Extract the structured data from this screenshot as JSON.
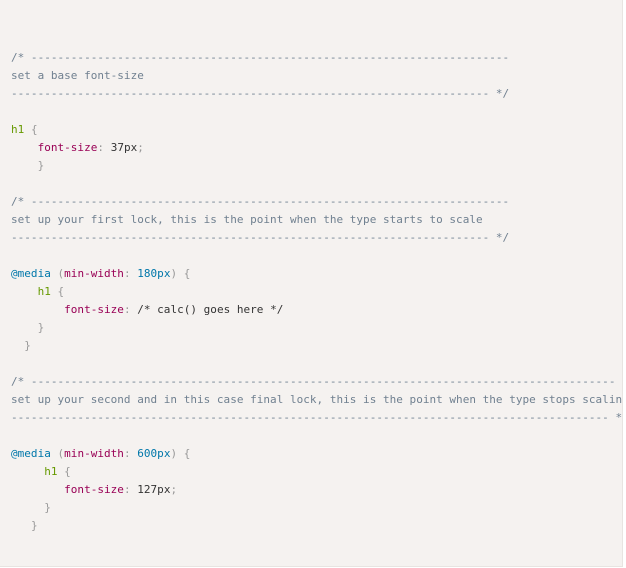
{
  "code": {
    "block1": {
      "comment_open": "/* ------------------------------------------------------------------------",
      "comment_text": "set a base font-size",
      "comment_close": "------------------------------------------------------------------------ */",
      "selector": "h1",
      "brace_open": " {",
      "property": "font-size",
      "colon": ":",
      "value": "37px",
      "semicolon": ";",
      "brace_close": "}"
    },
    "block2": {
      "comment_open": "/* ------------------------------------------------------------------------",
      "comment_text": "set up your first lock, this is the point when the type starts to scale",
      "comment_close": "------------------------------------------------------------------------ */",
      "at_rule": "@media",
      "paren_open": " (",
      "media_feature": "min-width",
      "media_colon": ": ",
      "media_value": "180px",
      "paren_close": ") {",
      "selector": "h1",
      "brace_open": " {",
      "property": "font-size",
      "colon": ":",
      "value": " /* calc() goes here */",
      "brace_close_inner": "}",
      "brace_close_outer": "}"
    },
    "block3": {
      "comment_open": "/* ----------------------------------------------------------------------------------------",
      "comment_text": "set up your second and in this case final lock, this is the point when the type stops scaling",
      "comment_close": "------------------------------------------------------------------------------------------ */",
      "at_rule": "@media",
      "paren_open": " (",
      "media_feature": "min-width",
      "media_colon": ": ",
      "media_value": "600px",
      "paren_close": ") {",
      "selector": "h1",
      "brace_open": " {",
      "property": "font-size",
      "colon": ":",
      "value": "127px",
      "semicolon": ";",
      "brace_close_inner": "}",
      "brace_close_outer": "}"
    }
  },
  "colors": {
    "background": "#f5f2f0",
    "comment": "#708090",
    "selector": "#669900",
    "property": "#990055",
    "atrule": "#0077aa",
    "punctuation": "#999999"
  }
}
